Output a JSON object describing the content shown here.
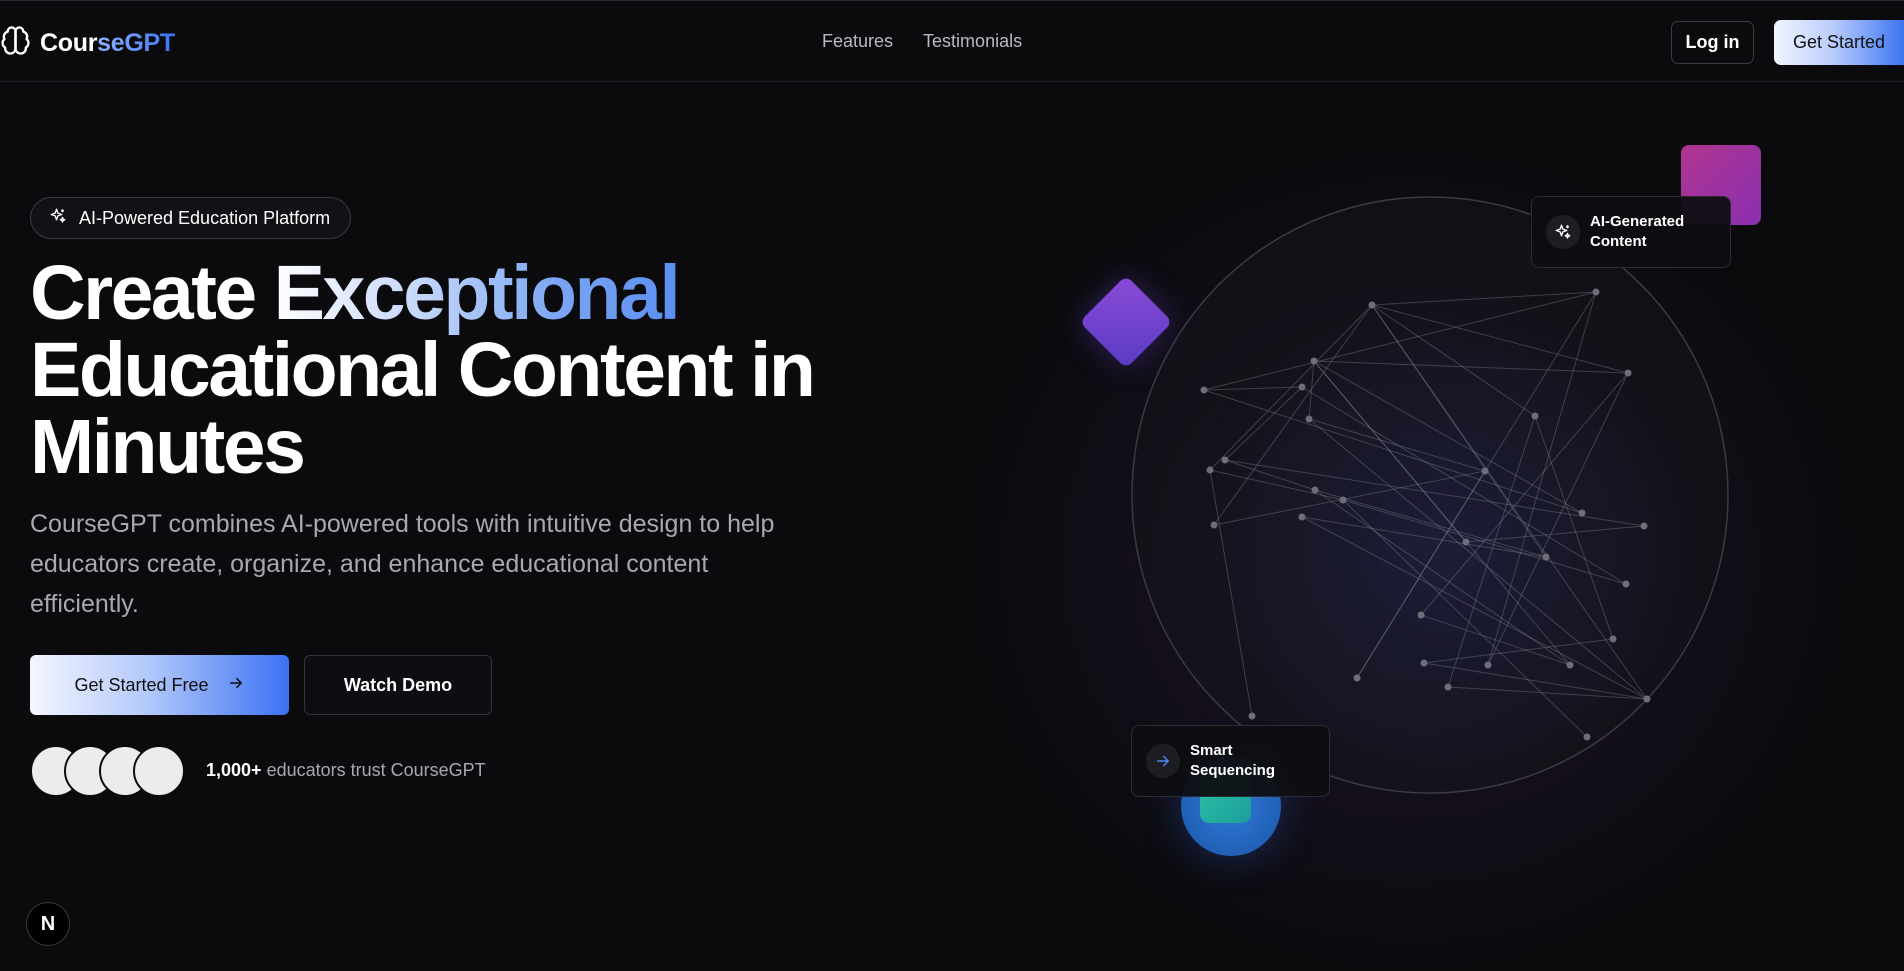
{
  "header": {
    "brand_prefix": "Cour",
    "brand_accent": "seGPT",
    "logo_icon": "brain-icon",
    "nav": [
      {
        "label": "Features"
      },
      {
        "label": "Testimonials"
      }
    ],
    "login_label": "Log in",
    "get_started_label": "Get Started"
  },
  "hero": {
    "badge_label": "AI-Powered Education Platform",
    "badge_icon": "sparkles-icon",
    "headline_plain": "Create ",
    "headline_accent": "Exceptional",
    "headline_rest": "Educational Content in Minutes",
    "lead": "CourseGPT combines AI-powered tools with intuitive design to help educators create, organize, and enhance educational content efficiently.",
    "primary_cta": "Get Started Free",
    "secondary_cta": "Watch Demo",
    "trust_count": "1,000+",
    "trust_text": " educators trust CourseGPT"
  },
  "visual": {
    "card_ai_label": "AI-Generated Content",
    "card_smart_label": "Smart Sequencing"
  },
  "dev_badge": "N",
  "colors": {
    "background": "#0b0b0e",
    "accent_blue": "#3b74f5",
    "accent_purple": "#6b45cf",
    "accent_pink": "#a3339c",
    "accent_teal": "#26b3a1"
  }
}
